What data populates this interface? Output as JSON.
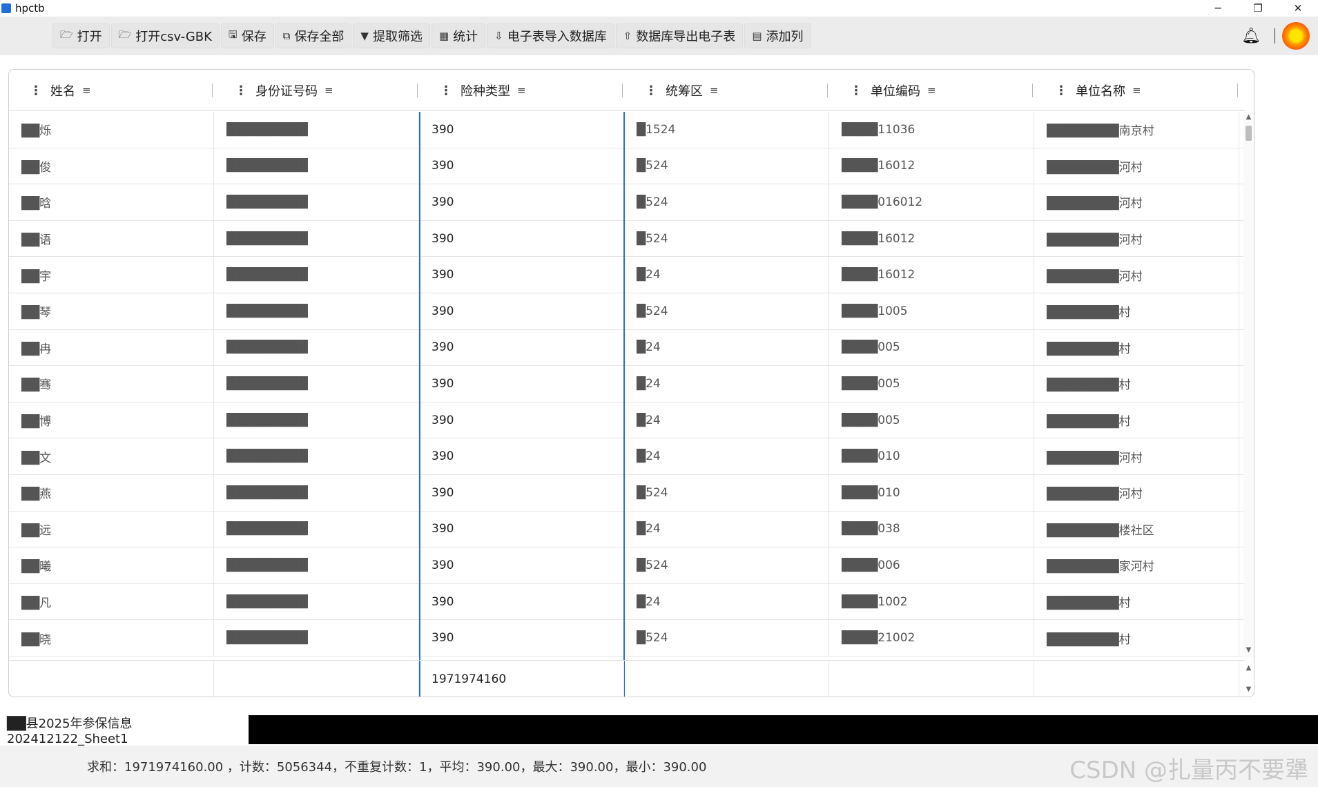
{
  "window": {
    "title": "hpctb",
    "controls": [
      "─",
      "❐",
      "✕"
    ]
  },
  "toolbar": {
    "buttons": [
      {
        "icon": "folder-open-icon",
        "glyph": "🗁",
        "label": "打开"
      },
      {
        "icon": "folder-open-icon",
        "glyph": "🗁",
        "label": "打开csv-GBK"
      },
      {
        "icon": "save-icon",
        "glyph": "🖫",
        "label": "保存"
      },
      {
        "icon": "save-all-icon",
        "glyph": "⧉",
        "label": "保存全部"
      },
      {
        "icon": "filter-icon",
        "glyph": "▼",
        "label": "提取筛选"
      },
      {
        "icon": "grid-icon",
        "glyph": "▦",
        "label": "统计"
      },
      {
        "icon": "import-icon",
        "glyph": "⇩",
        "label": "电子表导入数据库"
      },
      {
        "icon": "export-icon",
        "glyph": "⇧",
        "label": "数据库导出电子表"
      },
      {
        "icon": "table-icon",
        "glyph": "▤",
        "label": "添加列"
      }
    ]
  },
  "table": {
    "columns": [
      "姓名",
      "身份证号码",
      "险种类型",
      "统筹区",
      "单位编码",
      "单位名称"
    ],
    "rows": [
      [
        "██烁",
        "█████████",
        "390",
        "█1524",
        "████11036",
        "████████南京村"
      ],
      [
        "██俊",
        "█████████",
        "390",
        "█524",
        "████16012",
        "████████河村"
      ],
      [
        "██晗",
        "█████████",
        "390",
        "█524",
        "████016012",
        "████████河村"
      ],
      [
        "██语",
        "█████████",
        "390",
        "█524",
        "████16012",
        "████████河村"
      ],
      [
        "██宇",
        "█████████",
        "390",
        "█24",
        "████16012",
        "████████河村"
      ],
      [
        "██琴",
        "█████████",
        "390",
        "█524",
        "████1005",
        "████████村"
      ],
      [
        "██冉",
        "█████████",
        "390",
        "█24",
        "████005",
        "████████村"
      ],
      [
        "██骞",
        "█████████",
        "390",
        "█24",
        "████005",
        "████████村"
      ],
      [
        "██博",
        "█████████",
        "390",
        "█24",
        "████005",
        "████████村"
      ],
      [
        "██文",
        "█████████",
        "390",
        "█24",
        "████010",
        "████████河村"
      ],
      [
        "██燕",
        "█████████",
        "390",
        "█524",
        "████010",
        "████████河村"
      ],
      [
        "██远",
        "█████████",
        "390",
        "█24",
        "████038",
        "████████楼社区"
      ],
      [
        "██曦",
        "█████████",
        "390",
        "█524",
        "████006",
        "████████家河村"
      ],
      [
        "██凡",
        "█████████",
        "390",
        "█24",
        "████1002",
        "████████村"
      ],
      [
        "██晓",
        "█████████",
        "390",
        "█524",
        "████21002",
        "████████村"
      ]
    ],
    "footer": [
      "",
      "",
      "1971974160",
      "",
      "",
      ""
    ]
  },
  "sheet": {
    "tab_label": "██县2025年参保信息202412122_Sheet1"
  },
  "status": {
    "text": "求和：1971974160.00 ，计数：5056344，不重复计数：1，平均：390.00，最大：390.00，最小：390.00"
  },
  "watermark": "CSDN @扎量丙不要犟"
}
